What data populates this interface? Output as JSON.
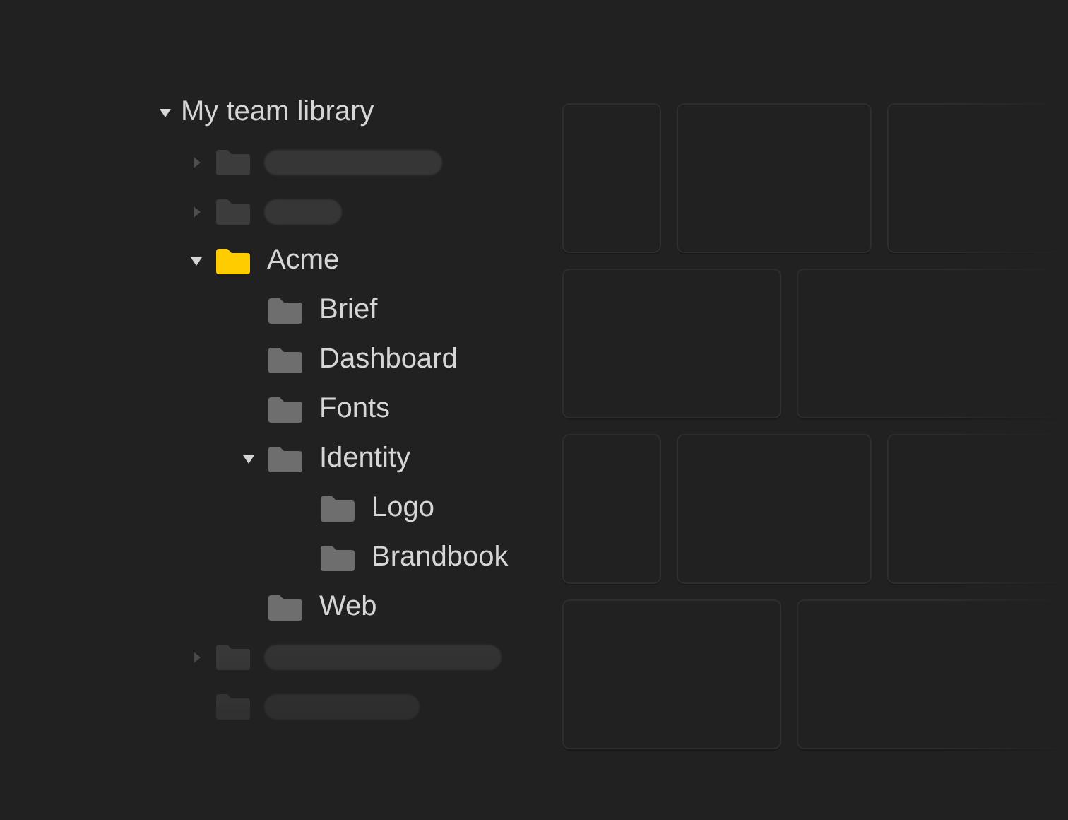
{
  "tree": {
    "label": "My team library",
    "expanded": true,
    "children": [
      {
        "kind": "placeholder",
        "expanded": false
      },
      {
        "kind": "placeholder",
        "expanded": false
      },
      {
        "kind": "folder",
        "label": "Acme",
        "selected": true,
        "expanded": true,
        "children": [
          {
            "kind": "folder",
            "label": "Brief",
            "selected": false
          },
          {
            "kind": "folder",
            "label": "Dashboard",
            "selected": false
          },
          {
            "kind": "folder",
            "label": "Fonts",
            "selected": false
          },
          {
            "kind": "folder",
            "label": "Identity",
            "selected": false,
            "expanded": true,
            "children": [
              {
                "kind": "folder",
                "label": "Logo",
                "selected": false
              },
              {
                "kind": "folder",
                "label": "Brandbook",
                "selected": false
              }
            ]
          },
          {
            "kind": "folder",
            "label": "Web",
            "selected": false
          }
        ]
      },
      {
        "kind": "placeholder",
        "expanded": false
      },
      {
        "kind": "placeholder"
      }
    ]
  }
}
